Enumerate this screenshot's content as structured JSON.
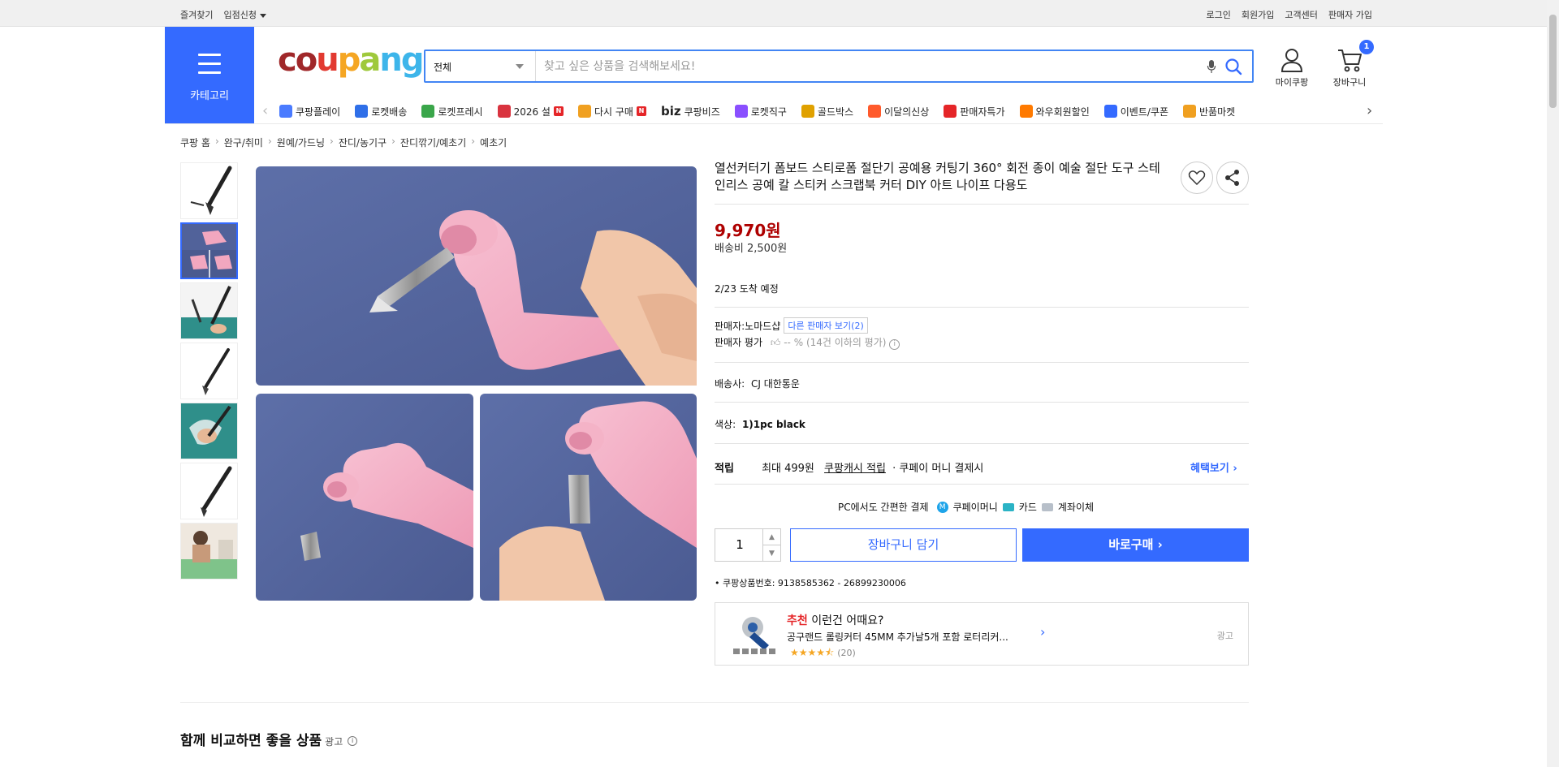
{
  "topbar": {
    "left": [
      "즐겨찾기",
      "입점신청"
    ],
    "right": [
      "로그인",
      "회원가입",
      "고객센터",
      "판매자 가입"
    ]
  },
  "header": {
    "category_label": "카테고리",
    "logo": "coupang",
    "search_category": "전체",
    "search_placeholder": "찾고 싶은 상품을 검색해보세요!",
    "mycoupang": "마이쿠팡",
    "cart": "장바구니",
    "cart_count": "1"
  },
  "nav": {
    "items": [
      {
        "label": "쿠팡플레이",
        "icon": "play-icon",
        "color": "#4a7bff"
      },
      {
        "label": "로켓배송",
        "icon": "rocket-icon",
        "color": "#2f6fe8"
      },
      {
        "label": "로켓프레시",
        "icon": "fresh-rocket-icon",
        "color": "#3aa64a"
      },
      {
        "label": "2026 설",
        "icon": "gift-icon",
        "color": "#d9333f",
        "badge": "N"
      },
      {
        "label": "다시 구매",
        "icon": "home-icon",
        "color": "#f0a020",
        "badge": "N"
      },
      {
        "label": "쿠팡비즈",
        "prefix": "biz",
        "icon": "biz-icon",
        "color": "#222"
      },
      {
        "label": "로켓직구",
        "icon": "global-rocket-icon",
        "color": "#8a4fff"
      },
      {
        "label": "골드박스",
        "icon": "goldbox-icon",
        "color": "#e0a100"
      },
      {
        "label": "이달의신상",
        "icon": "new-icon",
        "color": "#ff5a2c"
      },
      {
        "label": "판매자특가",
        "icon": "discount-icon",
        "color": "#e52528"
      },
      {
        "label": "와우회원할인",
        "icon": "wow-icon",
        "color": "#ff7a00"
      },
      {
        "label": "이벤트/쿠폰",
        "icon": "coupon-icon",
        "color": "#346aff"
      },
      {
        "label": "반품마켓",
        "icon": "market-icon",
        "color": "#f0a020"
      }
    ]
  },
  "breadcrumb": [
    "쿠팡 홈",
    "완구/취미",
    "원예/가드닝",
    "잔디/농기구",
    "잔디깎기/예초기",
    "예초기"
  ],
  "product": {
    "title": "열선커터기 폼보드 스티로폼 절단기 공예용 커팅기 360° 회전 종이 예술 절단 도구 스테인리스 공예 칼 스티커 스크랩북 커터 DIY 아트 나이프 다용도",
    "price": "9,970원",
    "shipping": "배송비 2,500원",
    "arrival": "2/23 도착 예정",
    "seller_label": "판매자:",
    "seller_name": "노마드샵",
    "other_sellers": "다른 판매자 보기(2)",
    "rating_label": "판매자 평가",
    "rating_value": "-- %",
    "rating_note": "(14건 이하의 평가)",
    "carrier_label": "배송사:",
    "carrier_value": "CJ 대한통운",
    "color_label": "색상:",
    "color_value": "1)1pc black",
    "points_label": "적립",
    "points_text1": "최대 499원",
    "points_link": "쿠팡캐시 적립",
    "points_text2": "· 쿠페이 머니 결제시",
    "benefit_link": "혜택보기",
    "pc_pay": "PC에서도 간편한 결제",
    "pay_methods": [
      "쿠페이머니",
      "카드",
      "계좌이체"
    ],
    "quantity": "1",
    "add_to_cart": "장바구니 담기",
    "buy_now": "바로구매",
    "product_id": "쿠팡상품번호: 9138585362 - 26899230006"
  },
  "recommend": {
    "prefix": "추천",
    "heading": "이런건 어때요?",
    "name": "공구랜드 롤링커터 45MM 추가날5개 포함 로터리커...",
    "review_count": "(20)",
    "ad": "광고"
  },
  "compare": {
    "title": "함께 비교하면 좋을 상품",
    "ad": "광고"
  }
}
